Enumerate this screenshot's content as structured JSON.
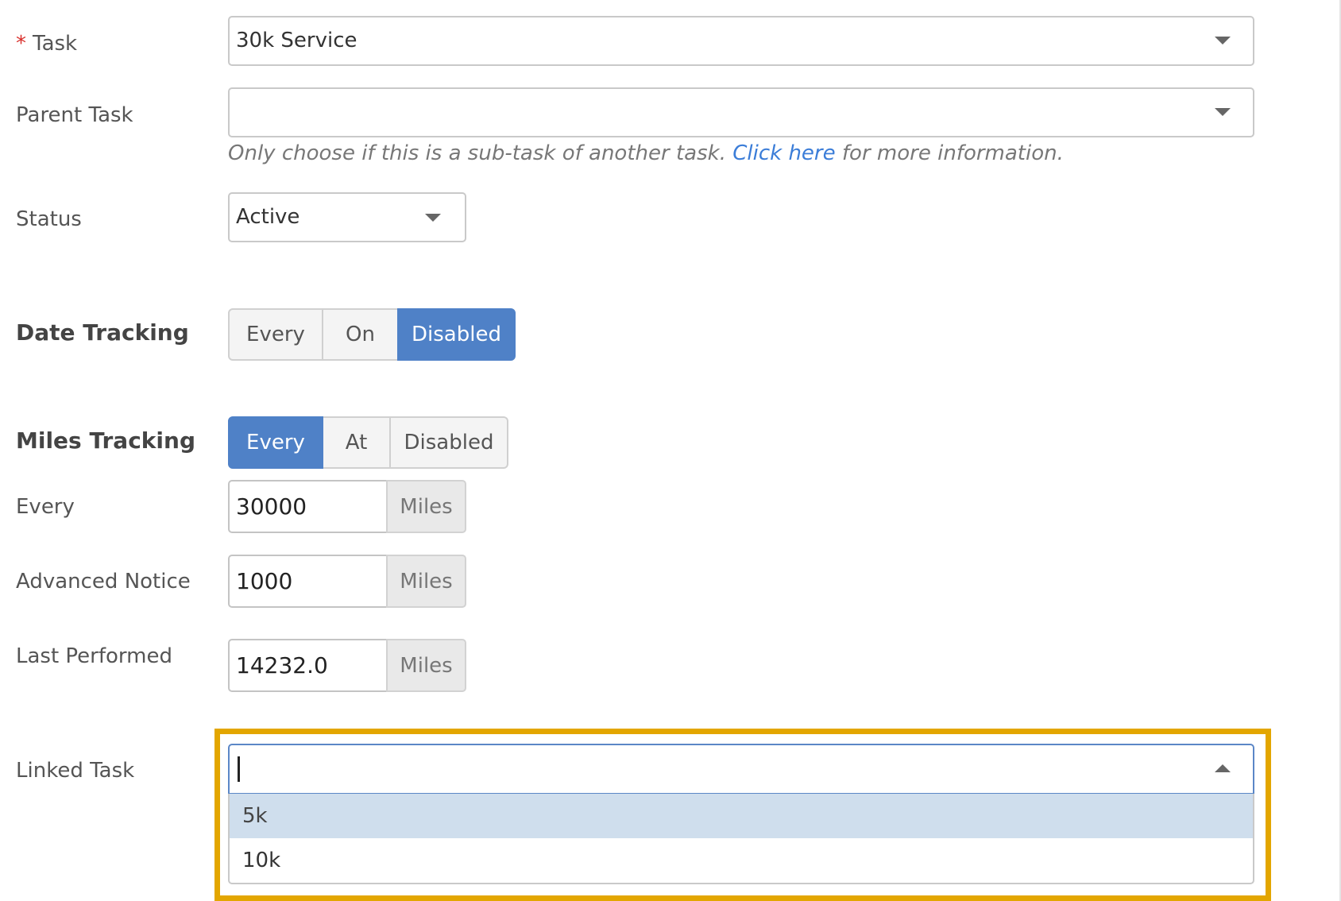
{
  "form": {
    "task": {
      "required_mark": "*",
      "label": "Task",
      "value": "30k Service"
    },
    "parent_task": {
      "label": "Parent Task",
      "value": "",
      "help_prefix": "Only choose if this is a sub-task of another task. ",
      "help_link": "Click here",
      "help_suffix": " for more information."
    },
    "status": {
      "label": "Status",
      "value": "Active"
    },
    "date_tracking": {
      "label": "Date Tracking",
      "options": [
        "Every",
        "On",
        "Disabled"
      ],
      "selected": "Disabled"
    },
    "miles_tracking": {
      "label": "Miles Tracking",
      "options": [
        "Every",
        "At",
        "Disabled"
      ],
      "selected": "Every"
    },
    "every": {
      "label": "Every",
      "value": "30000",
      "unit": "Miles"
    },
    "advanced_notice": {
      "label": "Advanced Notice",
      "value": "1000",
      "unit": "Miles"
    },
    "last_performed": {
      "label": "Last Performed",
      "value": "14232.0",
      "unit": "Miles"
    },
    "linked_task": {
      "label": "Linked Task",
      "value": "",
      "options": [
        "5k",
        "10k"
      ],
      "highlighted": "5k"
    }
  },
  "colors": {
    "accent": "#4f81c7",
    "required": "#d9302c",
    "link": "#3b7dd8",
    "highlight_border": "#e3a600",
    "option_hover": "#cfdeed"
  }
}
